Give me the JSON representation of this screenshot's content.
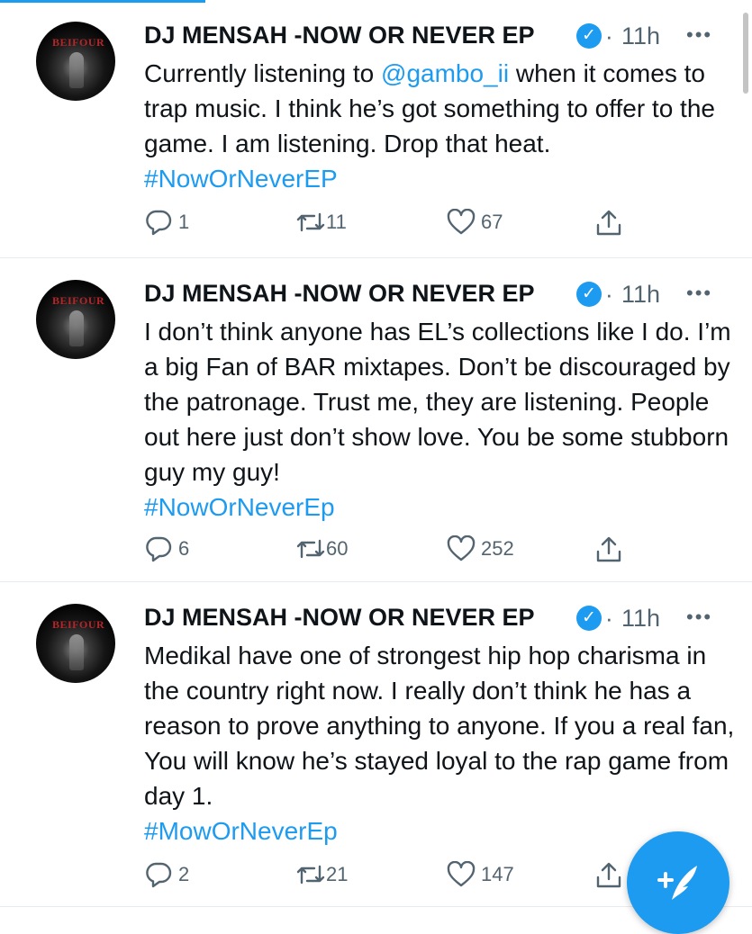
{
  "feed": {
    "tweets": [
      {
        "display_name": "DJ MENSAH -NOW OR NEVER EP",
        "separator": "·",
        "time": "11h",
        "avatar_text": "BEIFOUR",
        "text_before": "Currently listening to ",
        "mention": "@gambo_ii",
        "text_after": " when it comes to trap music. I think he’s got something to offer to the game. I am listening. Drop that heat. ",
        "hashtag": "#NowOrNeverEP",
        "replies": "1",
        "retweets": "11",
        "likes": "67"
      },
      {
        "display_name": "DJ MENSAH -NOW OR NEVER EP",
        "separator": "·",
        "time": "11h",
        "avatar_text": "BEIFOUR",
        "text": "I don’t think anyone has EL’s collections like I do. I’m a big Fan of BAR mixtapes. Don’t be discouraged by the patronage. Trust me, they are listening. People out here just don’t show love. You be some stubborn guy my guy!",
        "hashtag": "#NowOrNeverEp",
        "replies": "6",
        "retweets": "60",
        "likes": "252"
      },
      {
        "display_name": "DJ MENSAH -NOW OR NEVER EP",
        "separator": "·",
        "time": "11h",
        "avatar_text": "BEIFOUR",
        "text": "Medikal have one of strongest hip hop charisma in the country right now. I really don’t think he has a reason to prove anything to anyone. If you a real fan, You will know he’s stayed loyal to the rap game from day 1.",
        "hashtag": "#MowOrNeverEp",
        "replies": "2",
        "retweets": "21",
        "likes": "147"
      }
    ]
  },
  "icons": {
    "verified": "verified-badge-icon",
    "more": "more-options-icon",
    "reply": "reply-icon",
    "retweet": "retweet-icon",
    "like": "heart-icon",
    "share": "share-icon",
    "compose": "compose-feather-icon"
  },
  "colors": {
    "accent": "#1d9bf0",
    "text": "#0f1419",
    "muted": "#536471",
    "divider": "#e6ecf0"
  }
}
